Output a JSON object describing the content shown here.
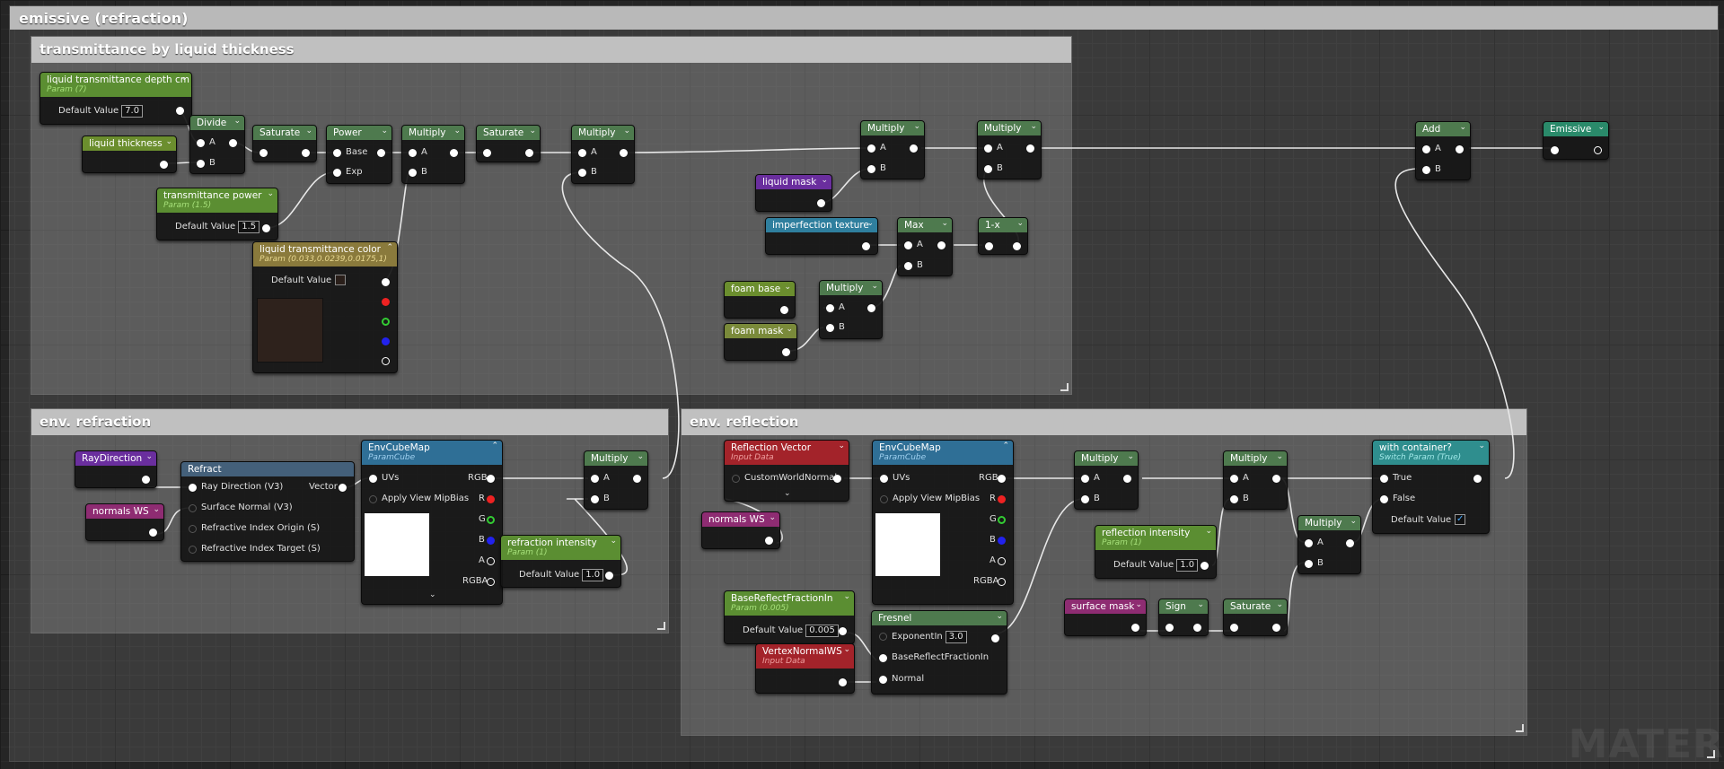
{
  "colors": {
    "scalar_param": "#5b8e32",
    "function": "#4e7a4e",
    "vector_param": "#8a7a3c",
    "texture": "#2f7f9e",
    "input_data": "#a3232a",
    "custom": "#6a2e9e",
    "named_reroute": "#8e2c72",
    "switch": "#2f8e8e",
    "output": "#2a8a6a",
    "comment_outer": "#b9b9b9",
    "comment_inner": "#c2c2c2"
  },
  "comments": {
    "emissive": "emissive (refraction)",
    "transmittance": "transmittance by liquid thickness",
    "env_refraction": "env. refraction",
    "env_reflection": "env. reflection"
  },
  "nodes": {
    "ltdc": {
      "title": "liquid transmittance depth cm",
      "sub": "Param (7)",
      "dv_label": "Default Value",
      "dv": "7.0"
    },
    "thickness": {
      "title": "liquid thickness"
    },
    "divide": {
      "title": "Divide",
      "a": "A",
      "b": "B"
    },
    "saturate1": {
      "title": "Saturate"
    },
    "power": {
      "title": "Power",
      "base": "Base",
      "exp": "Exp"
    },
    "mult1": {
      "title": "Multiply",
      "a": "A",
      "b": "B"
    },
    "saturate2": {
      "title": "Saturate"
    },
    "mult2": {
      "title": "Multiply",
      "a": "A",
      "b": "B"
    },
    "tpower": {
      "title": "transmittance power",
      "sub": "Param (1.5)",
      "dv_label": "Default Value",
      "dv": "1.5"
    },
    "ltcolor": {
      "title": "liquid transmittance color",
      "sub": "Param (0.033,0.0239,0.0175,1)",
      "dv_label": "Default Value"
    },
    "mult3": {
      "title": "Multiply",
      "a": "A",
      "b": "B"
    },
    "mult4": {
      "title": "Multiply",
      "a": "A",
      "b": "B"
    },
    "lmask": {
      "title": "liquid mask"
    },
    "imperf": {
      "title": "imperfection texture"
    },
    "max": {
      "title": "Max",
      "a": "A",
      "b": "B"
    },
    "oneminus": {
      "title": "1-x"
    },
    "fbase": {
      "title": "foam base"
    },
    "fmask": {
      "title": "foam mask"
    },
    "mult5": {
      "title": "Multiply",
      "a": "A",
      "b": "B"
    },
    "add": {
      "title": "Add",
      "a": "A",
      "b": "B"
    },
    "emissive": {
      "title": "Emissive"
    },
    "raydir": {
      "title": "RayDirection"
    },
    "nws1": {
      "title": "normals WS"
    },
    "refract": {
      "title": "Refract",
      "in1": "Ray Direction (V3)",
      "in2": "Surface Normal (V3)",
      "in3": "Refractive Index Origin (S)",
      "in4": "Refractive Index Target (S)",
      "out": "Vector"
    },
    "cube1": {
      "title": "EnvCubeMap",
      "sub": "ParamCube",
      "uvs": "UVs",
      "mip": "Apply View MipBias",
      "rgb": "RGB",
      "r": "R",
      "g": "G",
      "b": "B",
      "a": "A",
      "rgba": "RGBA"
    },
    "mult6": {
      "title": "Multiply",
      "a": "A",
      "b": "B"
    },
    "rint": {
      "title": "refraction intensity",
      "sub": "Param (1)",
      "dv_label": "Default Value",
      "dv": "1.0"
    },
    "reflvec": {
      "title": "Reflection Vector",
      "sub": "Input Data",
      "pin": "CustomWorldNormal"
    },
    "nws2": {
      "title": "normals WS"
    },
    "cube2": {
      "title": "EnvCubeMap",
      "sub": "ParamCube",
      "uvs": "UVs",
      "mip": "Apply View MipBias",
      "rgb": "RGB",
      "r": "R",
      "g": "G",
      "b": "B",
      "a": "A",
      "rgba": "RGBA"
    },
    "mult7": {
      "title": "Multiply",
      "a": "A",
      "b": "B"
    },
    "mult8": {
      "title": "Multiply",
      "a": "A",
      "b": "B"
    },
    "mult9": {
      "title": "Multiply",
      "a": "A",
      "b": "B"
    },
    "container": {
      "title": "with container?",
      "sub": "Switch Param (True)",
      "true": "True",
      "false": "False",
      "dv_label": "Default Value",
      "check": "✓"
    },
    "reflint": {
      "title": "reflection intensity",
      "sub": "Param (1)",
      "dv_label": "Default Value",
      "dv": "1.0"
    },
    "brf": {
      "title": "BaseReflectFractionIn",
      "sub": "Param (0.005)",
      "dv_label": "Default Value",
      "dv": "0.005"
    },
    "fresnel": {
      "title": "Fresnel",
      "exp_label": "ExponentIn",
      "exp": "3.0",
      "brf": "BaseReflectFractionIn",
      "normal": "Normal"
    },
    "vnws": {
      "title": "VertexNormalWS",
      "sub": "Input Data"
    },
    "smask": {
      "title": "surface mask"
    },
    "sign": {
      "title": "Sign"
    },
    "saturate3": {
      "title": "Saturate"
    }
  },
  "watermark": "MATER"
}
